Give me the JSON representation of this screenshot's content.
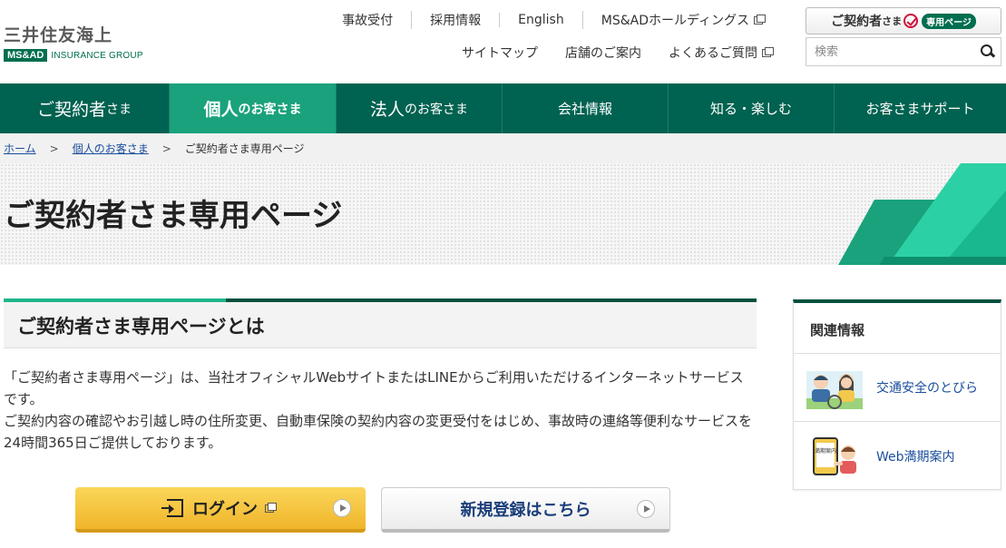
{
  "header": {
    "logo_jp": "三井住友海上",
    "logo_msad": "MS&AD",
    "logo_group": "INSURANCE GROUP",
    "util_row1": [
      "事故受付",
      "採用情報",
      "English",
      "MS&ADホールディングス"
    ],
    "util_row2": [
      "サイトマップ",
      "店舗のご案内",
      "よくあるご質問"
    ],
    "contract_button": {
      "main": "ご契約者",
      "small": "さま",
      "tag": "専用ページ"
    },
    "search_placeholder": "検索"
  },
  "gnav": [
    {
      "main": "ご契約者",
      "sub": "さま"
    },
    {
      "main": "個人",
      "sub": "のお客さま"
    },
    {
      "main": "法人",
      "sub": "のお客さま"
    },
    {
      "main": "会社情報"
    },
    {
      "main": "知る・楽しむ"
    },
    {
      "main": "お客さまサポート"
    }
  ],
  "breadcrumb": [
    "ホーム",
    "個人のお客さま",
    "ご契約者さま専用ページ"
  ],
  "breadcrumb_sep": ">",
  "page_title": "ご契約者さま専用ページ",
  "section": {
    "heading": "ご契約者さま専用ページとは",
    "paragraph1": "「ご契約者さま専用ページ」は、当社オフィシャルWebサイトまたはLINEからご利用いただけるインターネットサービスです。",
    "paragraph2": "ご契約内容の確認やお引越し時の住所変更、自動車保険の契約内容の変更受付をはじめ、事故時の連絡等便利なサービスを24時間365日ご提供しております。"
  },
  "buttons": {
    "login": "ログイン",
    "register": "新規登録はこちら"
  },
  "sidebar": {
    "title": "関連情報",
    "links": [
      "交通安全のとびら",
      "Web満期案内"
    ],
    "thumb_text": "満期案内"
  },
  "colors": {
    "brand_green": "#006250",
    "accent_green": "#1aa27c",
    "login_yellow": "#f0b52a",
    "link_blue": "#1a4d9c"
  }
}
